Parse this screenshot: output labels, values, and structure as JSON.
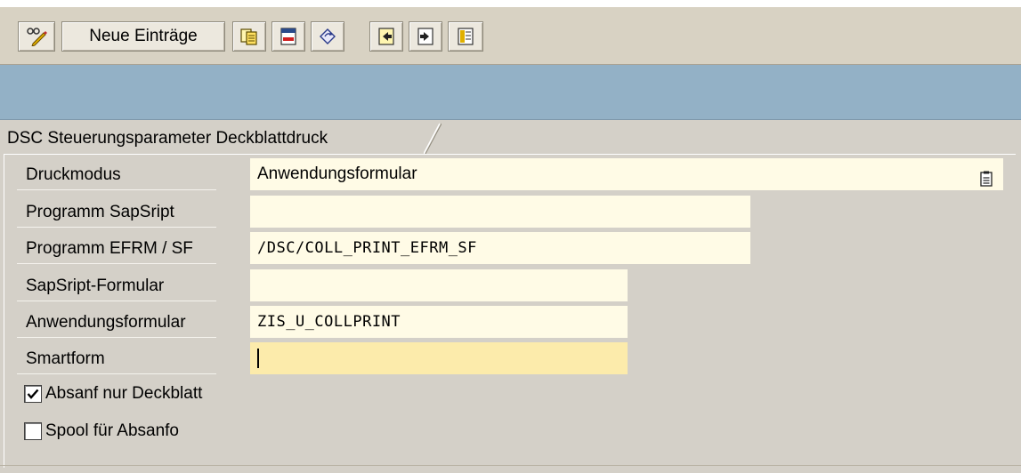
{
  "toolbar": {
    "buttons": [
      {
        "name": "display-change-button",
        "icon": "pencil-glasses-icon"
      },
      {
        "name": "new-entries-button",
        "label": "Neue Einträge"
      },
      {
        "name": "copy-button",
        "icon": "copy-icon"
      },
      {
        "name": "delete-button",
        "icon": "delete-icon"
      },
      {
        "name": "undo-change-button",
        "icon": "undo-icon"
      },
      {
        "name": "previous-entry-button",
        "icon": "previous-entry-icon"
      },
      {
        "name": "next-entry-button",
        "icon": "next-entry-icon"
      },
      {
        "name": "select-block-button",
        "icon": "select-block-icon"
      }
    ]
  },
  "tab": {
    "title": "DSC Steuerungsparameter Deckblattdruck"
  },
  "form": {
    "rows": [
      {
        "label": "Druckmodus",
        "value": "Anwendungsformular"
      },
      {
        "label": "Programm SapSript",
        "value": ""
      },
      {
        "label": "Programm EFRM / SF",
        "value": "/DSC/COLL_PRINT_EFRM_SF"
      },
      {
        "label": "SapSript-Formular",
        "value": ""
      },
      {
        "label": "Anwendungsformular",
        "value": "ZIS_U_COLLPRINT"
      },
      {
        "label": "Smartform",
        "value": ""
      }
    ],
    "checkboxes": [
      {
        "label": "Absanf nur Deckblatt",
        "checked": true
      },
      {
        "label": "Spool für Absanfo",
        "checked": false
      }
    ]
  },
  "colors": {
    "field_bg": "#fffbe6",
    "active_field_bg": "#fcebab",
    "header_band": "#93b1c6",
    "window_bg": "#d4d0c8"
  }
}
